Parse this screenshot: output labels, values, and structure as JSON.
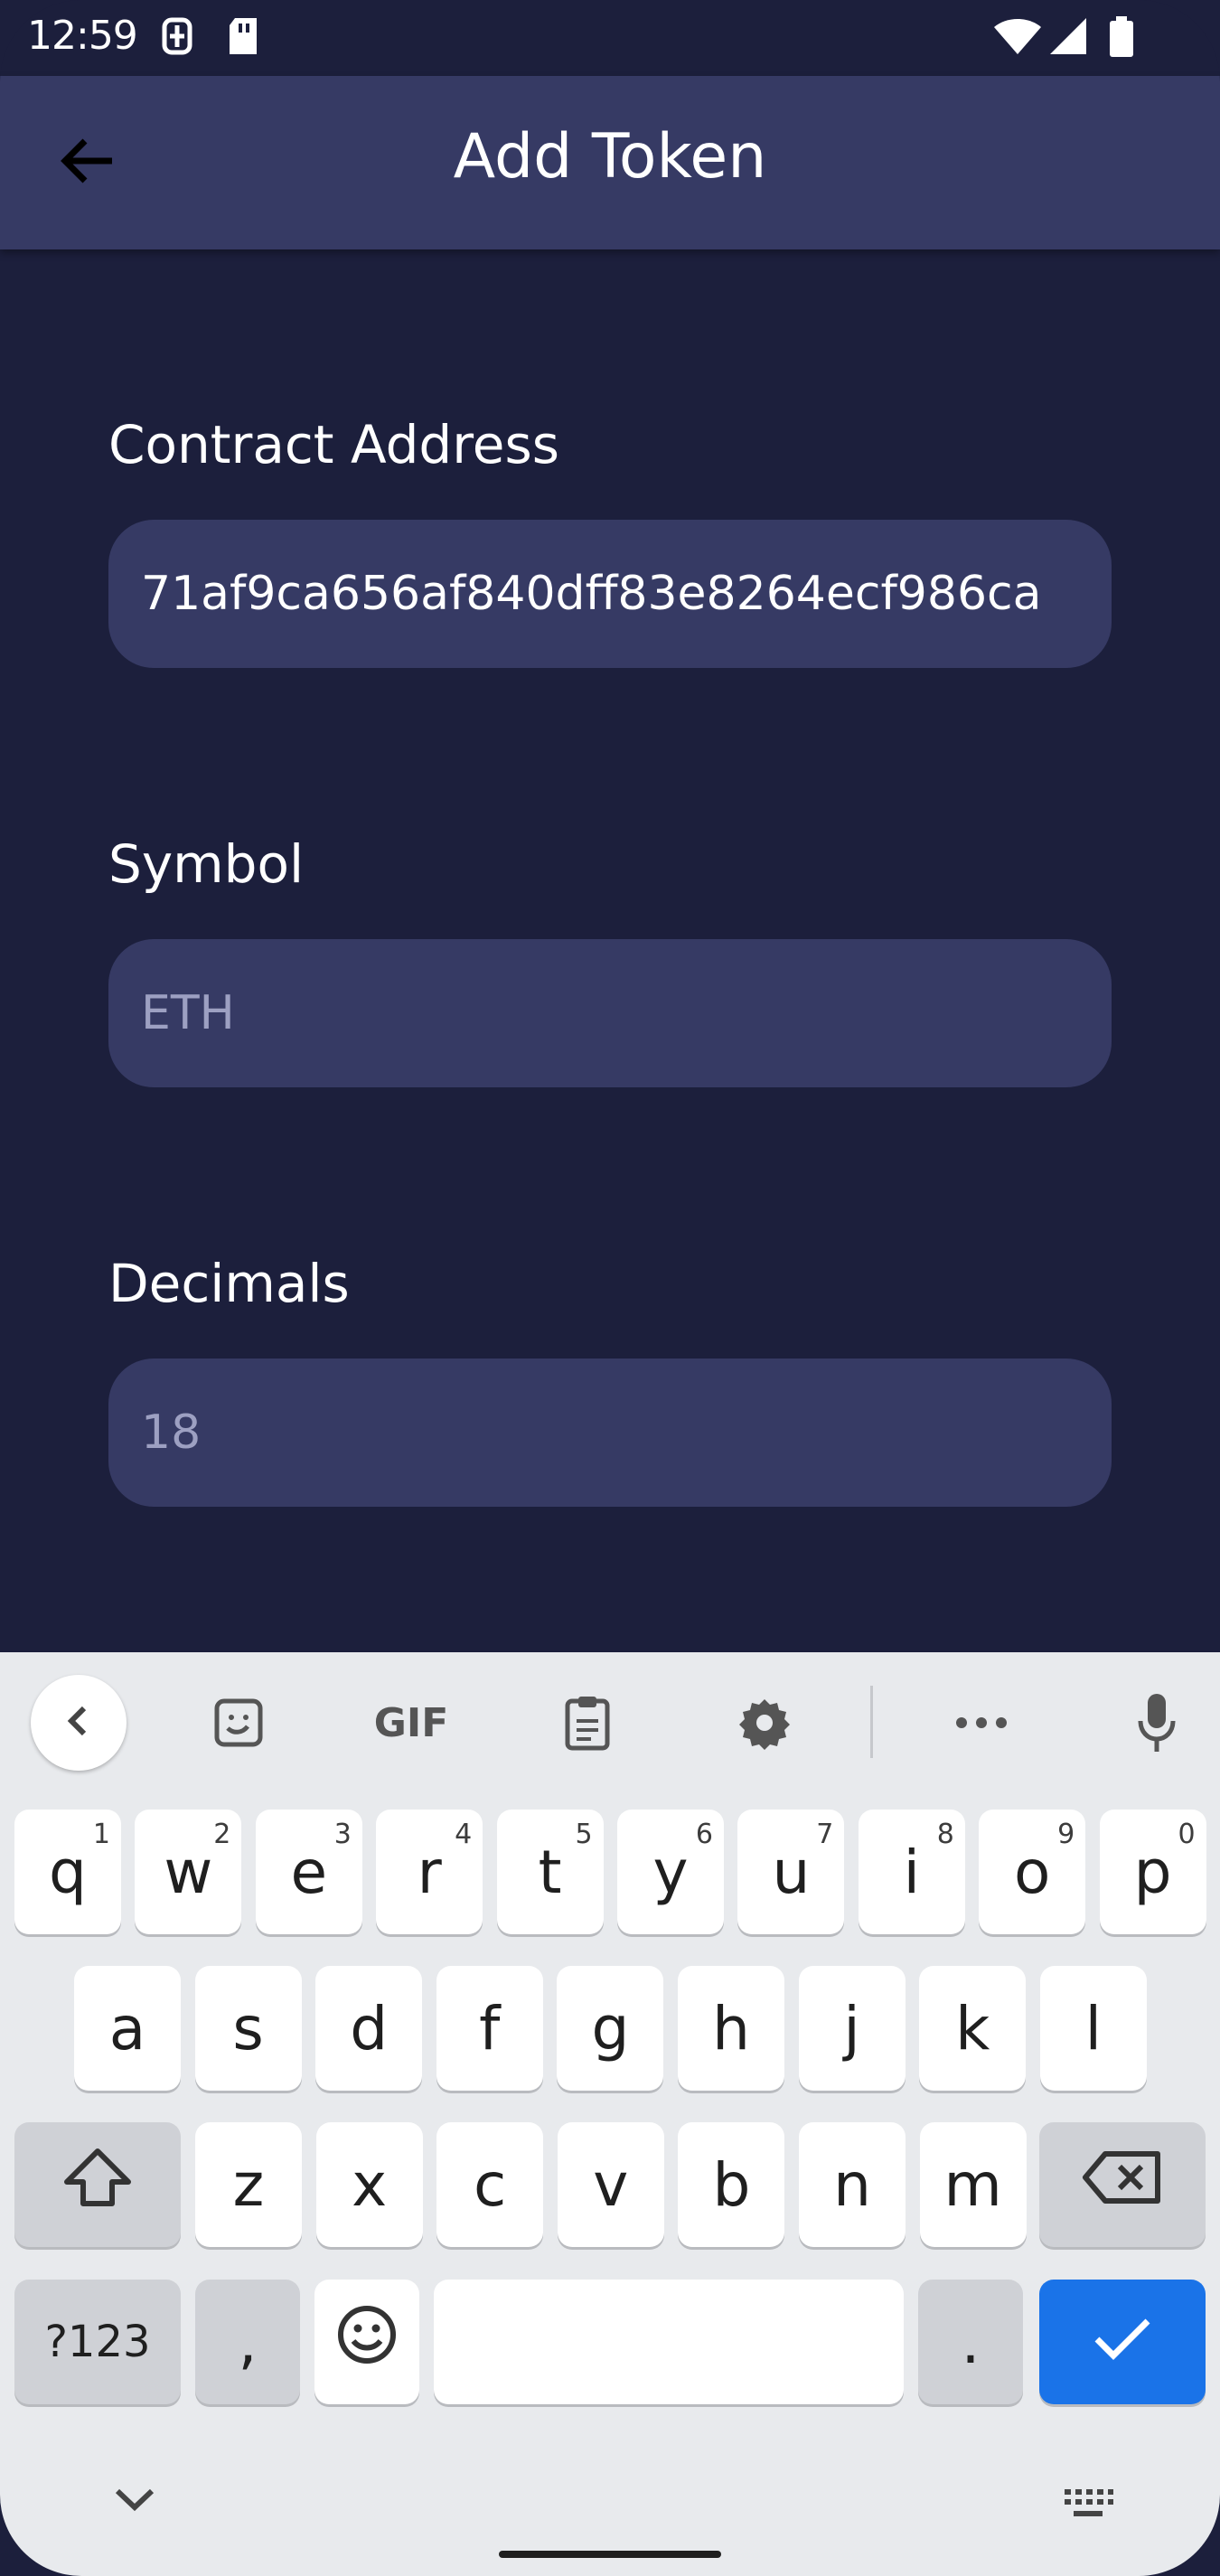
{
  "status_bar": {
    "time": "12:59",
    "icons": [
      "sim-manager-icon",
      "sd-card-icon",
      "wifi-icon",
      "cellular-signal-icon",
      "battery-icon"
    ]
  },
  "app_bar": {
    "title": "Add Token",
    "back_icon": "arrow-back-icon"
  },
  "form": {
    "contract_address": {
      "label": "Contract Address",
      "value": "71af9ca656af840dff83e8264ecf986ca"
    },
    "symbol": {
      "label": "Symbol",
      "placeholder": "ETH"
    },
    "decimals": {
      "label": "Decimals",
      "placeholder": "18"
    }
  },
  "keyboard": {
    "toolbar": [
      "collapse-icon",
      "sticker-icon",
      "gif-icon",
      "clipboard-icon",
      "settings-icon",
      "more-icon",
      "microphone-icon"
    ],
    "gif_label": "GIF",
    "row1": [
      {
        "key": "q",
        "hint": "1"
      },
      {
        "key": "w",
        "hint": "2"
      },
      {
        "key": "e",
        "hint": "3"
      },
      {
        "key": "r",
        "hint": "4"
      },
      {
        "key": "t",
        "hint": "5"
      },
      {
        "key": "y",
        "hint": "6"
      },
      {
        "key": "u",
        "hint": "7"
      },
      {
        "key": "i",
        "hint": "8"
      },
      {
        "key": "o",
        "hint": "9"
      },
      {
        "key": "p",
        "hint": "0"
      }
    ],
    "row2": [
      "a",
      "s",
      "d",
      "f",
      "g",
      "h",
      "j",
      "k",
      "l"
    ],
    "row3": [
      "z",
      "x",
      "c",
      "v",
      "b",
      "n",
      "m"
    ],
    "row4": {
      "symbols": "?123",
      "comma": ",",
      "period": "."
    },
    "colors": {
      "key_bg": "#ffffff",
      "special_key_bg": "#cfd1d6",
      "enter_key_bg": "#1a73e8",
      "keyboard_bg": "#e8eaed"
    }
  },
  "colors": {
    "background": "#1c1f3c",
    "app_bar": "#363a64",
    "field_bg": "#363a64",
    "hint_text": "#9da0c2"
  }
}
